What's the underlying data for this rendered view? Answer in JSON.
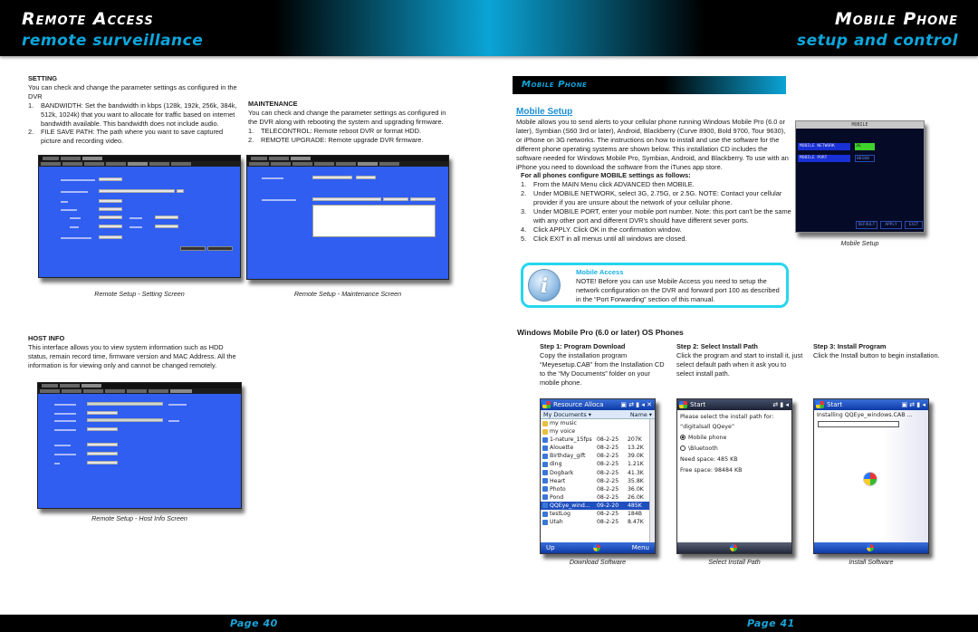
{
  "header": {
    "left_title": "Remote Access",
    "left_subtitle": "remote surveillance",
    "right_title": "Mobile Phone",
    "right_subtitle": "setup and control"
  },
  "setting": {
    "heading": "SETTING",
    "intro": "You can check and change the parameter settings as configured in the DVR",
    "items": [
      {
        "n": "1.",
        "text": "BANDWIDTH: Set the bandwidth in kbps (128k, 192k, 256k, 384k, 512k, 1024k) that you want to allocate for traffic based on internet bandwidth available. This bandwidth does not include audio."
      },
      {
        "n": "2.",
        "text": "FILE SAVE PATH: The path where you want to save captured picture and recording video."
      }
    ],
    "caption": "Remote Setup - Setting Screen"
  },
  "maintenance": {
    "heading": "MAINTENANCE",
    "intro": "You can check and change the parameter settings as configured in the DVR along with rebooting the system and upgrading firmware.",
    "items": [
      {
        "n": "1.",
        "text": "TELECONTROL: Remote reboot DVR or format HDD."
      },
      {
        "n": "2.",
        "text": "REMOTE UPGRADE: Remote upgrade DVR firmware."
      }
    ],
    "caption": "Remote Setup - Maintenance Screen"
  },
  "host_info": {
    "heading": "HOST INFO",
    "intro": "This interface allows you to view system information such as HDD status, remain record time, firmware version and MAC Address. All the information is for viewing only and cannot be changed remotely.",
    "caption": "Remote Setup - Host Info Screen"
  },
  "mobile_phone": {
    "band_title": "Mobile Phone",
    "setup_title": "Mobile Setup",
    "intro": "Mobile allows you to send alerts to your cellular phone running Windows Mobile Pro (6.0 or later), Symbian (S60 3rd or later), Android, Blackberry (Curve 8900, Bold 9700, Tour 9630), or iPhone on 3G networks. The instructions on how to install and use the software for the different phone operating systems are shown below. This installation CD includes the software needed for Windows Mobile Pro, Symbian, Android, and Blackberry. To use with an iPhone you need to download the software from the iTunes app store.",
    "config_heading": "For all phones configure MOBILE settings as follows:",
    "steps": [
      {
        "n": "1.",
        "text": "From the MAIN Menu click ADVANCED then MOBILE."
      },
      {
        "n": "2.",
        "text": "Under MOBILE NETWORK, select 3G, 2.75G, or 2.5G. NOTE: Contact your cellular provider if you are unsure about the network of your cellular phone."
      },
      {
        "n": "3.",
        "text": "Under MOBILE PORT, enter your mobile port number. Note: this port can't be the same with any other port and different DVR's should have different sever ports."
      },
      {
        "n": "4.",
        "text": "Click APPLY. Click OK in the confirmation window."
      },
      {
        "n": "5.",
        "text": "Click EXIT in all menus until all windows are closed."
      }
    ],
    "dvr_screen": {
      "title": "MOBILE",
      "network_label": "MOBILE  NETWORK",
      "network_value": "3G",
      "port_label": "MOBILE    PORT",
      "port_value": "00100",
      "buttons": [
        "DEFAULT",
        "APPLY",
        "EXIT"
      ]
    },
    "dvr_caption": "Mobile Setup"
  },
  "note": {
    "title": "Mobile Access",
    "body": "NOTE! Before you can use Mobile Access you need to setup the network configuration on the DVR and forward port 100 as described in the “Port Forwarding” section of this manual."
  },
  "windows_mobile": {
    "title": "Windows Mobile Pro (6.0 or later) OS Phones",
    "steps": [
      {
        "title": "Step 1: Program Download",
        "text": "Copy the installation program “Meyesetup.CAB” from the Installation CD to the “My Documents” folder on your mobile phone.",
        "caption": "Download Software"
      },
      {
        "title": "Step 2: Select Install Path",
        "text": "Click the program and start to install it, just select default path when it ask you to select install path.",
        "caption": "Select Install Path"
      },
      {
        "title": "Step 3: Install Program",
        "text": "Click the Install button to begin installation.",
        "caption": "Install Software"
      }
    ],
    "phone1": {
      "title": "Resource Alloca",
      "folder": "My Documents ▾",
      "sort": "Name ▾",
      "files": [
        {
          "name": "my music",
          "date": "",
          "size": "",
          "folder": true
        },
        {
          "name": "my voice",
          "date": "",
          "size": "",
          "folder": true
        },
        {
          "name": "1-nature_15fps",
          "date": "08-2-25",
          "size": "207K"
        },
        {
          "name": "Alouette",
          "date": "08-2-25",
          "size": "13.2K"
        },
        {
          "name": "Birthday_gift",
          "date": "08-2-25",
          "size": "39.0K"
        },
        {
          "name": "ding",
          "date": "08-2-25",
          "size": "1.21K"
        },
        {
          "name": "Dogbark",
          "date": "08-2-25",
          "size": "41.3K"
        },
        {
          "name": "Heart",
          "date": "08-2-25",
          "size": "35.8K"
        },
        {
          "name": "Photo",
          "date": "08-2-25",
          "size": "36.0K"
        },
        {
          "name": "Pond",
          "date": "08-2-25",
          "size": "26.0K"
        },
        {
          "name": "QQEye_wind...",
          "date": "09-2-20",
          "size": "485K",
          "selected": true
        },
        {
          "name": "testLog",
          "date": "08-2-25",
          "size": "184B"
        },
        {
          "name": "Utah",
          "date": "08-2-25",
          "size": "8.47K"
        }
      ],
      "left_soft": "Up",
      "right_soft": "Menu"
    },
    "phone2": {
      "title": "Start",
      "prompt": "Please select the install path for:",
      "app": "“digitalsall QQeye”",
      "option1": "Mobile phone",
      "option2": "\\Bluetooth",
      "need_space": "Need space:  485 KB",
      "free_space": "Free space:  98484 KB"
    },
    "phone3": {
      "title": "Start",
      "installing": "Installing QQEye_windows.CAB ..."
    }
  },
  "footer": {
    "left_page": "Page  40",
    "right_page": "Page  41"
  }
}
